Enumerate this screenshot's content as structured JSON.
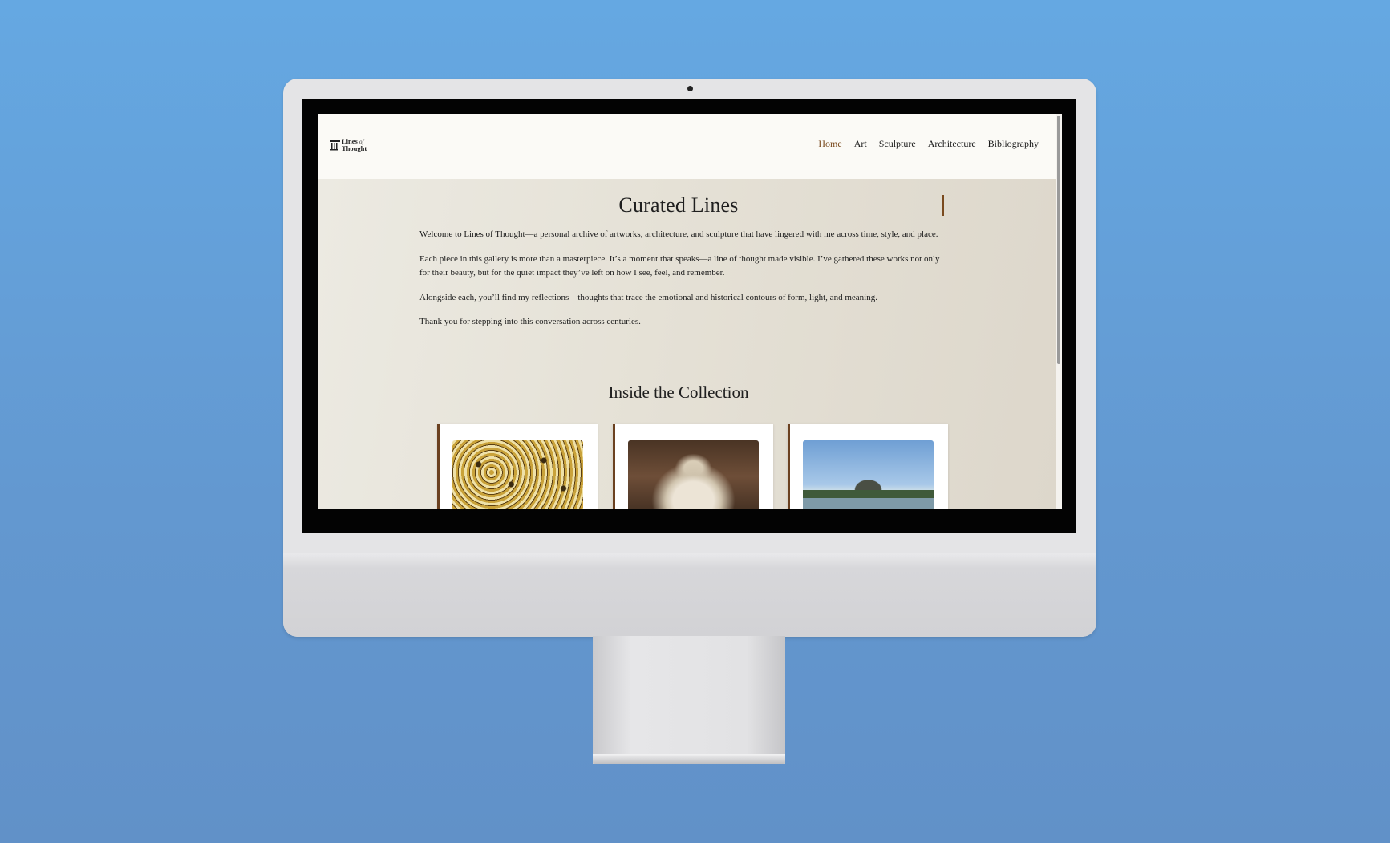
{
  "site": {
    "logo": {
      "line1": "Lines",
      "of": "of",
      "line2": "Thought"
    },
    "nav": [
      {
        "label": "Home",
        "active": true
      },
      {
        "label": "Art",
        "active": false
      },
      {
        "label": "Sculpture",
        "active": false
      },
      {
        "label": "Architecture",
        "active": false
      },
      {
        "label": "Bibliography",
        "active": false
      }
    ],
    "colors": {
      "accent": "#7a4a1e",
      "header_bg": "#fbfaf6",
      "page_bg": "#e6e1d6",
      "card_border": "#6b4120"
    }
  },
  "main": {
    "title": "Curated Lines",
    "paragraphs": [
      "Welcome to Lines of Thought—a personal archive of artworks, architecture, and sculpture that have lingered with me across time, style, and place.",
      "Each piece in this gallery is more than a masterpiece. It’s a moment that speaks—a line of thought made visible. I’ve gathered these works not only for their beauty, but for the quiet impact they’ve left on how I see, feel, and remember.",
      "Alongside each, you’ll find my reflections—thoughts that trace the emotional and historical contours of form, light, and meaning.",
      "Thank you for stepping into this conversation across centuries."
    ],
    "collection_title": "Inside the Collection",
    "cards": [
      {
        "image": "klimt-tree-of-life-image"
      },
      {
        "image": "pieta-sculpture-image"
      },
      {
        "image": "angkor-wat-image"
      }
    ]
  }
}
